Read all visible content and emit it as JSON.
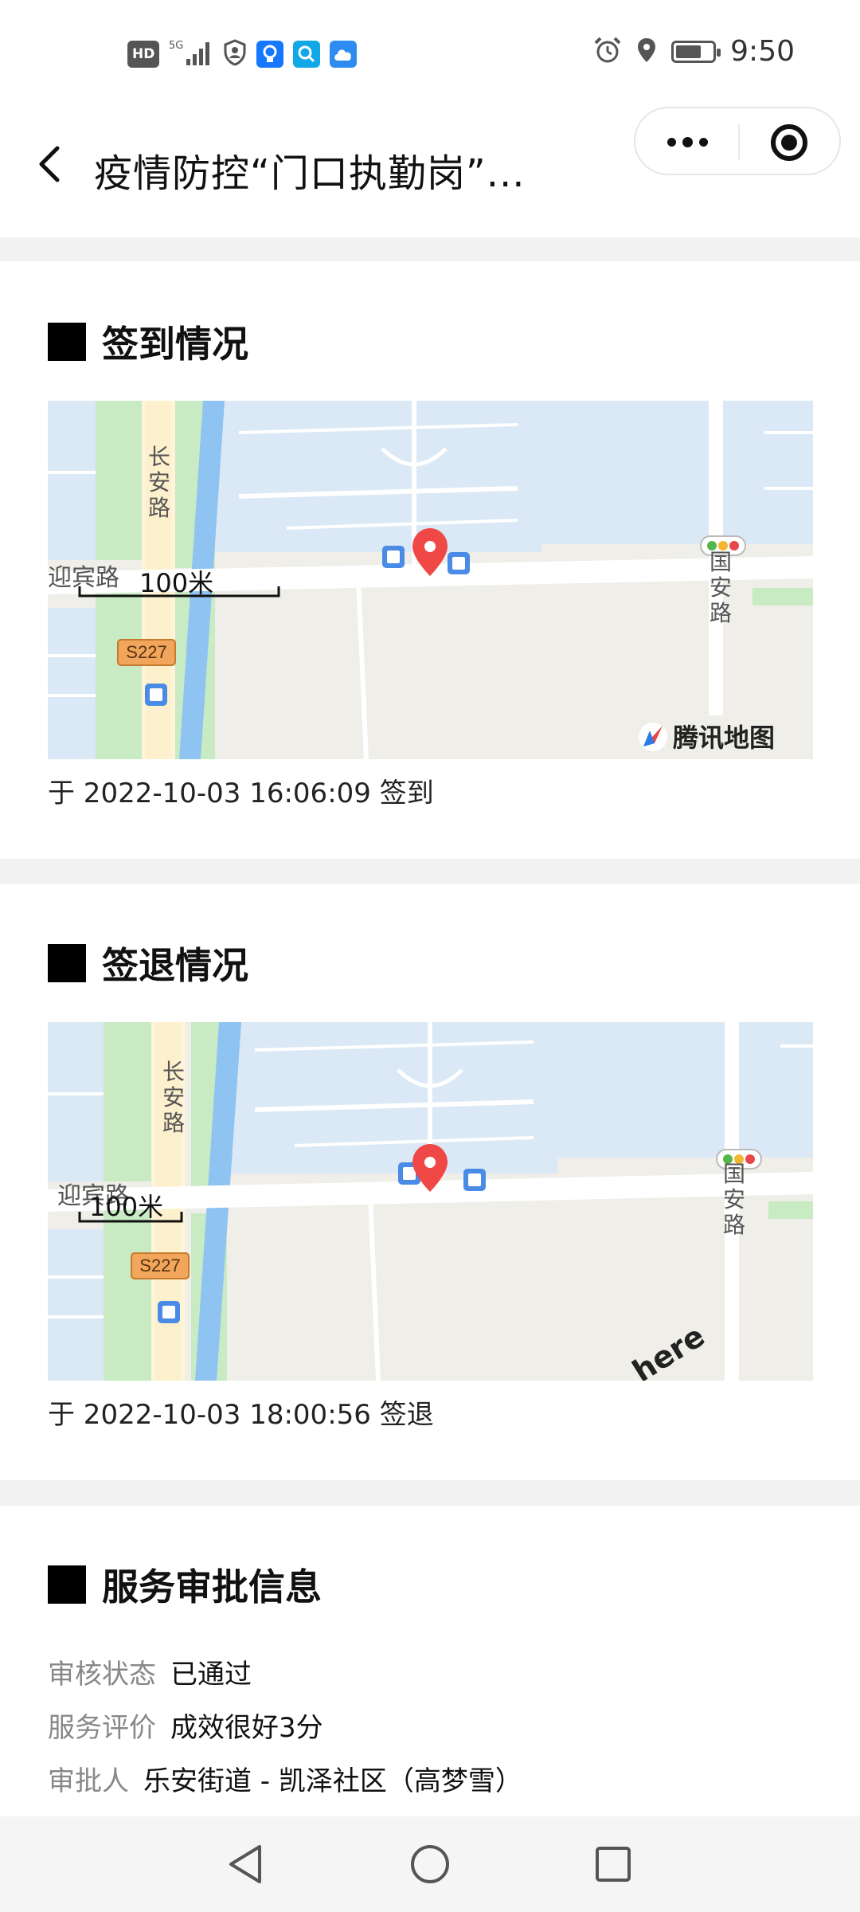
{
  "status_bar": {
    "hd": "HD",
    "network": "5G",
    "time": "9:50",
    "battery_level": 0.7
  },
  "title_bar": {
    "title": "疫情防控“门口执勤岗”...",
    "back_icon": "back-arrow-icon",
    "more_icon": "more-dots-icon",
    "close_icon": "target-close-icon"
  },
  "checkin": {
    "heading": "签到情况",
    "map": {
      "road_changan": "长安路",
      "road_yingbin": "迎宾路",
      "road_guoan": "国安路",
      "highway_tag": "S227",
      "scale_label": "100米",
      "provider": "腾讯地图"
    },
    "time_text": "于 2022-10-03 16:06:09 签到"
  },
  "checkout": {
    "heading": "签退情况",
    "map": {
      "road_changan": "长安路",
      "road_yingbin": "迎宾路",
      "road_guoan": "国安路",
      "highway_tag": "S227",
      "scale_label": "100米",
      "provider": "here"
    },
    "time_text": "于 2022-10-03 18:00:56 签退"
  },
  "approval": {
    "heading": "服务审批信息",
    "rows": [
      {
        "label": "审核状态",
        "value": "已通过"
      },
      {
        "label": "服务评价",
        "value": "成效很好3分"
      },
      {
        "label": "审批人",
        "value": "乐安街道 - 凯泽社区（高梦雪）"
      }
    ]
  },
  "nav_bar": {
    "back": "nav-back-icon",
    "home": "nav-home-icon",
    "recents": "nav-recents-icon"
  },
  "colors": {
    "map_water": "#dbe8f5",
    "map_green": "#c9ebc4",
    "map_river": "#8ec3f2",
    "map_base": "#efeee9",
    "pin_red": "#f04747"
  }
}
